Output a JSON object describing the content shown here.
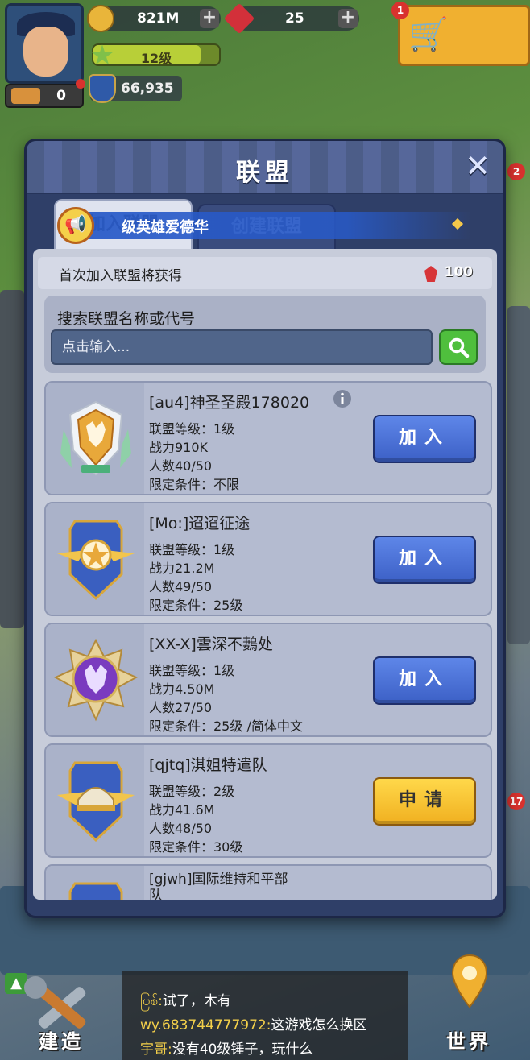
{
  "hud": {
    "coins": "821M",
    "gems": "25",
    "level": "12级",
    "power": "66,935",
    "rank_count": "0",
    "notification_badge": "1",
    "side_badge_1": "2",
    "side_badge_2": "17"
  },
  "modal": {
    "title": "联盟",
    "tabs": [
      {
        "label": "加入联盟",
        "active": true
      },
      {
        "label": "创建联盟",
        "active": false
      }
    ],
    "broadcast": "级英雄爱德华",
    "reward": {
      "text": "首次加入联盟将获得",
      "gems": "100"
    },
    "search": {
      "label": "搜索联盟名称或代号",
      "placeholder": "点击输入..."
    },
    "alliances": [
      {
        "name": "[au4]神圣圣殿178020",
        "level": "联盟等级：1级",
        "power": "战力910K",
        "members": "人数40/50",
        "requirement": "限定条件：不限",
        "button": "加入",
        "button_type": "join",
        "emblem": "wolf-shield-emblem",
        "has_info": true
      },
      {
        "name": "[Mo:]迢迢征途",
        "level": "联盟等级：1级",
        "power": "战力21.2M",
        "members": "人数49/50",
        "requirement": "限定条件：25级",
        "button": "加入",
        "button_type": "join",
        "emblem": "star-wings-emblem",
        "has_info": false
      },
      {
        "name": "[XX-X]雲深不鶈处",
        "level": "联盟等级：1级",
        "power": "战力4.50M",
        "members": "人数27/50",
        "requirement": "限定条件：25级 /简体中文",
        "button": "加入",
        "button_type": "join",
        "emblem": "purple-wolf-emblem",
        "has_info": false
      },
      {
        "name": "[qjtq]淇姐特遣队",
        "level": "联盟等级：2级",
        "power": "战力41.6M",
        "members": "人数48/50",
        "requirement": "限定条件：30级",
        "button": "申请",
        "button_type": "apply",
        "emblem": "helmet-wings-emblem",
        "has_info": false
      },
      {
        "name": "[gjwh]国际维持和平部",
        "name_line2": "队",
        "emblem": "star-wings-emblem"
      }
    ]
  },
  "bottom": {
    "build_label": "建造",
    "world_label": "世界",
    "chat": [
      {
        "sender": "ပြစ်:",
        "message": "试了，木有"
      },
      {
        "sender": "wy.683744777972:",
        "message": "这游戏怎么换区"
      },
      {
        "sender": "宇哥:",
        "message": "没有40级锤子，玩什么"
      }
    ]
  },
  "colors": {
    "join_button": "#4a6fd6",
    "apply_button": "#f5c22e",
    "search_button": "#4fbf3d",
    "modal_bg": "#2f3f68"
  }
}
